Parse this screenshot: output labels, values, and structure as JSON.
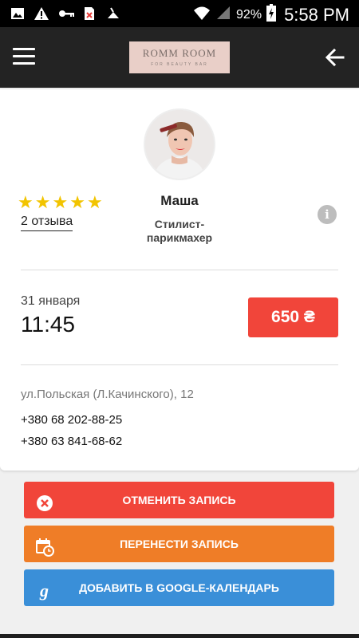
{
  "status_bar": {
    "battery": "92%",
    "time": "5:58 PM",
    "icons": [
      "image-icon",
      "warning-icon",
      "key-icon",
      "sim-off-icon",
      "vacuum-icon",
      "wifi-icon",
      "signal-icon",
      "battery-icon"
    ]
  },
  "app_bar": {
    "logo_title": "ROMM ROOM",
    "logo_subtitle": "FOR BEAUTY BAR",
    "menu_icon": "hamburger-icon",
    "back_icon": "arrow-back-icon"
  },
  "master": {
    "name": "Маша",
    "role": "Стилист-парикмахер",
    "rating": 5,
    "rating_max": 5,
    "reviews": "2 отзыва"
  },
  "appointment": {
    "date": "31 января",
    "time": "11:45",
    "price": "650 ₴"
  },
  "salon": {
    "address": "ул.Польская (Л.Качинского), 12",
    "phones": [
      "+380 68 202-88-25",
      "+380 63 841-68-62"
    ]
  },
  "actions": {
    "cancel": "ОТМЕНИТЬ ЗАПИСЬ",
    "reschedule": "ПЕРЕНЕСТИ ЗАПИСЬ",
    "add_google": "ДОБАВИТЬ В GOOGLE-КАЛЕНДАРЬ"
  },
  "colors": {
    "red": "#f1453a",
    "orange": "#ef7d27",
    "blue": "#3a8fd8",
    "star": "#f2c400",
    "app_bar": "#232323"
  }
}
